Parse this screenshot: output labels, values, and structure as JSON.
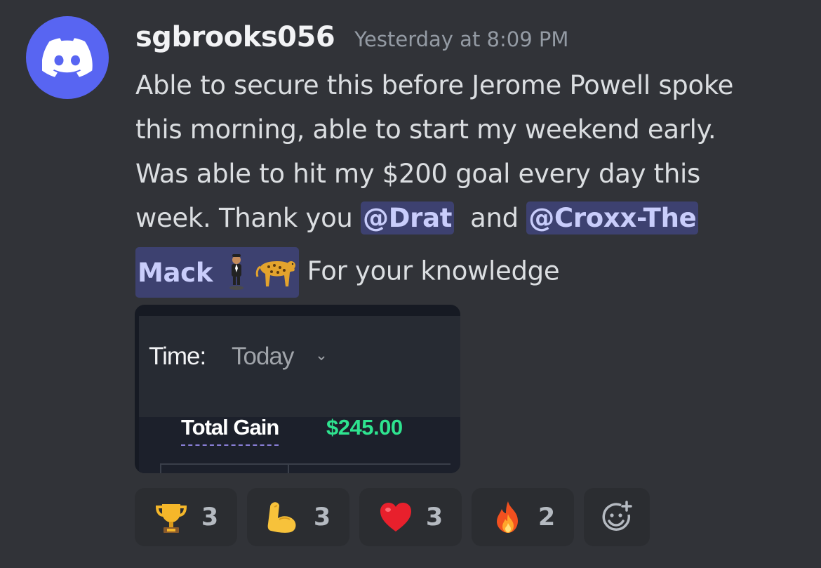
{
  "author": {
    "username": "sgbrooks056",
    "timestamp": "Yesterday at 8:09 PM",
    "avatar_icon": "discord-logo-icon",
    "avatar_color": "#5865f2"
  },
  "message": {
    "line1": "Able to secure this before Jerome Powell spoke",
    "line2": "this morning, able to start my weekend early.",
    "line3": "Was able to hit my $200 goal every day this",
    "line4_prefix": "week. Thank you ",
    "mention1": "@Drat",
    "line4_middle": "  and ",
    "mention2_part1": "@Croxx-The",
    "mention2_part2": "Mack",
    "mention2_emojis": [
      "man-in-suit-levitating-icon",
      "leopard-icon"
    ],
    "line5_suffix": " For your knowledge"
  },
  "embed": {
    "time_label": "Time:",
    "time_value": "Today",
    "total_gain_label": "Total Gain",
    "total_gain_value": "$245.00",
    "gain_color": "#2ee38f"
  },
  "reactions": [
    {
      "emoji": "trophy-icon",
      "count": "3"
    },
    {
      "emoji": "flexed-biceps-icon",
      "count": "3"
    },
    {
      "emoji": "red-heart-icon",
      "count": "3"
    },
    {
      "emoji": "fire-icon",
      "count": "2"
    }
  ],
  "add_reaction_icon": "add-reaction-icon"
}
